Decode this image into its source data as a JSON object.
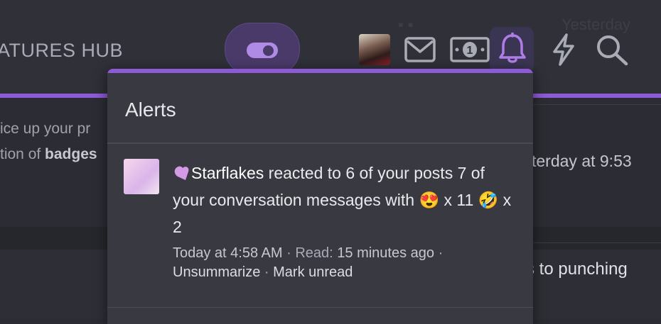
{
  "header": {
    "site_title": "ATURES HUB",
    "ghost_right_text": "Yesterday"
  },
  "nav_icons": [
    "toggle-icon",
    "avatar",
    "mail-icon",
    "money-icon",
    "bell-icon",
    "bolt-icon",
    "search-icon"
  ],
  "money_label": "1",
  "background": {
    "text_line1": "ice up your pr",
    "text_line2_prefix": "tion of ",
    "text_line2_bold": "badges",
    "right_line1": "terday at 9:53",
    "right_line2": "s to punching"
  },
  "alerts": {
    "title": "Alerts",
    "items": [
      {
        "user": "Starflakes",
        "text_before": " reacted to 6 of your posts 7 of your conversation messages with ",
        "emoji1": "😍",
        "count1": " x 11 ",
        "emoji2": "🤣",
        "count2": " x 2",
        "time": "Today at 4:58 AM",
        "read_label": "Read:",
        "read_value": "15 minutes ago",
        "action1": "Unsummarize",
        "action2": "Mark unread"
      }
    ]
  },
  "colors": {
    "accent": "#8e5ad6",
    "bg": "#2b2c33",
    "panel": "#383941"
  }
}
